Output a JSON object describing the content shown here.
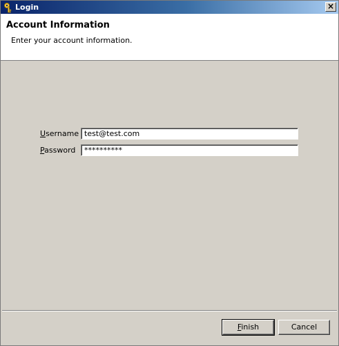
{
  "window": {
    "title": "Login",
    "close_glyph": "×",
    "icon": "key-icon"
  },
  "header": {
    "title": "Account Information",
    "description": "Enter your account information."
  },
  "form": {
    "username": {
      "mnemonic": "U",
      "label_rest": "sername",
      "value": "test@test.com"
    },
    "password": {
      "mnemonic": "P",
      "label_rest": "assword",
      "value": "**********"
    }
  },
  "buttons": {
    "finish": {
      "mnemonic": "F",
      "label_rest": "inish"
    },
    "cancel": {
      "label": "Cancel"
    }
  },
  "colors": {
    "titlebar_start": "#0a246a",
    "titlebar_end": "#a6caf0",
    "dialog_face": "#d4d0c8",
    "header_bg": "#ffffff"
  }
}
